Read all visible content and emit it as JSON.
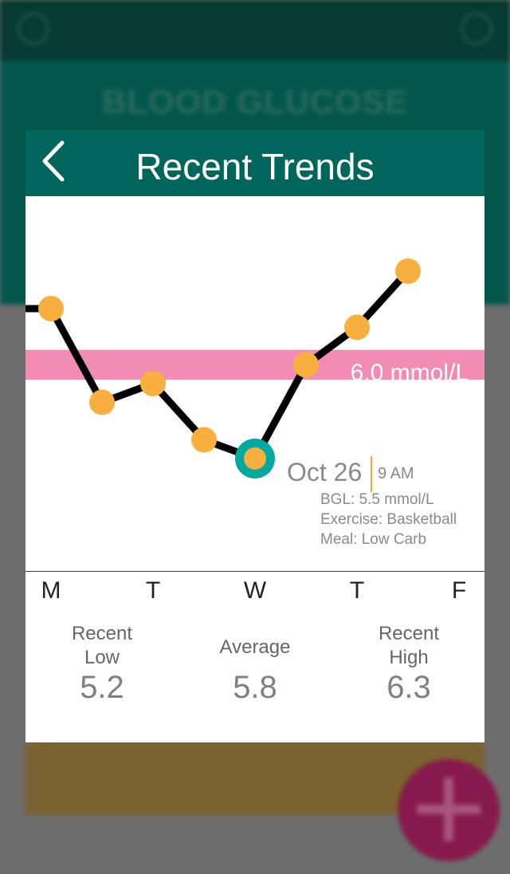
{
  "background": {
    "title": "BLOOD GLUCOSE",
    "small_text": "",
    "colors": {
      "topbar": "#063a32",
      "header": "#03574a",
      "content": "#6d6d6d",
      "card": "#7a6330",
      "fab": "#871a4c"
    },
    "icons": [
      "menu-icon",
      "user-icon",
      "plus-icon"
    ]
  },
  "modal": {
    "title": "Recent Trends",
    "back_icon": "chevron-left-icon",
    "header_color": "#00665b"
  },
  "chart_data": {
    "type": "line",
    "x": [
      -0.5,
      0,
      0.5,
      1,
      1.5,
      2,
      2.5,
      3,
      3.5,
      4,
      4.5
    ],
    "values": [
      6.3,
      6.3,
      5.8,
      5.9,
      5.6,
      5.5,
      6.0,
      6.2,
      6.5,
      null,
      null
    ],
    "categories": [
      "M",
      "T",
      "W",
      "T",
      "F"
    ],
    "ylim": [
      4.9,
      6.9
    ],
    "target": {
      "value": 6.0,
      "label": "6.0 mmol/L",
      "color": "#f38cb5"
    },
    "colors": {
      "line": "#000000",
      "point": "#f8af3f",
      "selected_ring": "#00a99d"
    },
    "selected_index": 5,
    "tooltip": {
      "date": "Oct 26",
      "time": "9 AM",
      "details": [
        "BGL: 5.5 mmol/L",
        "Exercise: Basketball",
        "Meal: Low Carb"
      ]
    }
  },
  "stats": {
    "recent_low": {
      "label_line1": "Recent",
      "label_line2": "Low",
      "value": "5.2"
    },
    "average": {
      "label": "Average",
      "value": "5.8"
    },
    "recent_high": {
      "label_line1": "Recent",
      "label_line2": "High",
      "value": "6.3"
    }
  }
}
